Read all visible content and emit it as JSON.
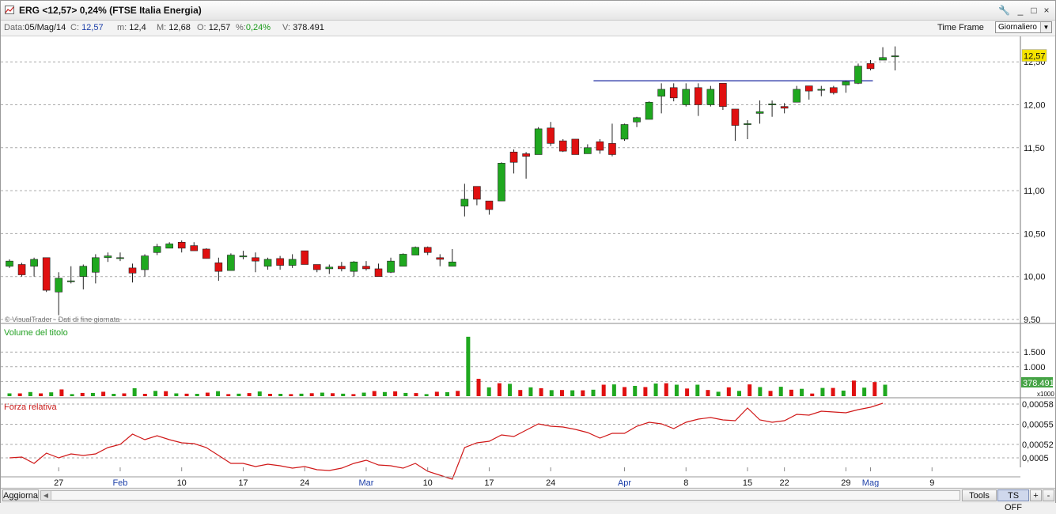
{
  "window": {
    "title": "ERG <12,57> 0,24%  (FTSE Italia Energia)",
    "buttons": [
      "🔧",
      "_",
      "□",
      "×"
    ]
  },
  "infobar": {
    "data_label": "Data:",
    "data_value": "05/Mag/14",
    "close_label": "C:",
    "close_value": "12,57",
    "min_label": "m:",
    "min_value": "12,4",
    "max_label": "M:",
    "max_value": "12,68",
    "open_label": "O:",
    "open_value": "12,57",
    "pct_label": "%:",
    "pct_value": "0,24%",
    "vol_label": "V:",
    "vol_value": "378.491",
    "timeframe_label": "Time Frame",
    "timeframe_value": "Giornaliero"
  },
  "bottombar": {
    "refresh": "Aggiorna",
    "tools": "Tools",
    "ts": "TS OFF",
    "plus": "+",
    "minus": "-"
  },
  "colors": {
    "up": "#1fa81f",
    "down": "#e01010",
    "rs_line": "#d01818",
    "resistance": "#1c2aa0",
    "last_price_bg": "#f5e400",
    "volume_tag_bg": "#45a345"
  },
  "chart_data": {
    "type": "candlestick",
    "watermark": "© VisualTrader - Dati di fine giornata",
    "price_axis": {
      "ticks": [
        9.5,
        10.0,
        10.5,
        11.0,
        11.5,
        12.0,
        12.5
      ],
      "tick_labels": [
        "9,50",
        "10,00",
        "10,50",
        "11,00",
        "11,50",
        "12,00",
        "12,50"
      ],
      "range": [
        9.5,
        12.85
      ],
      "last_price_label": "12,57",
      "grid": true
    },
    "x_axis": {
      "labels": [
        {
          "text": "27",
          "index": 4,
          "month": false
        },
        {
          "text": "Feb",
          "index": 9,
          "month": true
        },
        {
          "text": "10",
          "index": 14,
          "month": false
        },
        {
          "text": "17",
          "index": 19,
          "month": false
        },
        {
          "text": "24",
          "index": 24,
          "month": false
        },
        {
          "text": "Mar",
          "index": 29,
          "month": true
        },
        {
          "text": "10",
          "index": 34,
          "month": false
        },
        {
          "text": "17",
          "index": 39,
          "month": false
        },
        {
          "text": "24",
          "index": 44,
          "month": false
        },
        {
          "text": "Apr",
          "index": 50,
          "month": true
        },
        {
          "text": "8",
          "index": 55,
          "month": false
        },
        {
          "text": "15",
          "index": 60,
          "month": false
        },
        {
          "text": "22",
          "index": 63,
          "month": false
        },
        {
          "text": "29",
          "index": 68,
          "month": false
        },
        {
          "text": "Mag",
          "index": 70,
          "month": true
        },
        {
          "text": "9",
          "index": 75,
          "month": false
        }
      ]
    },
    "resistance_line": {
      "from_index": 48,
      "to_index": 70,
      "value": 12.28
    },
    "candles": [
      [
        10.12,
        10.18,
        10.1,
        10.2
      ],
      [
        10.14,
        10.02,
        10.0,
        10.16
      ],
      [
        10.12,
        10.2,
        10.0,
        10.22
      ],
      [
        10.22,
        9.84,
        9.82,
        10.22
      ],
      [
        9.82,
        9.98,
        9.55,
        10.05
      ],
      [
        9.95,
        9.95,
        9.92,
        10.12
      ],
      [
        10.0,
        10.12,
        9.85,
        10.14
      ],
      [
        10.05,
        10.22,
        9.92,
        10.26
      ],
      [
        10.22,
        10.24,
        10.17,
        10.28
      ],
      [
        10.22,
        10.22,
        10.18,
        10.28
      ],
      [
        10.1,
        10.04,
        9.93,
        10.15
      ],
      [
        10.08,
        10.24,
        10.0,
        10.26
      ],
      [
        10.28,
        10.35,
        10.25,
        10.38
      ],
      [
        10.33,
        10.38,
        10.33,
        10.4
      ],
      [
        10.4,
        10.33,
        10.28,
        10.42
      ],
      [
        10.36,
        10.3,
        10.3,
        10.4
      ],
      [
        10.32,
        10.21,
        10.21,
        10.33
      ],
      [
        10.16,
        10.06,
        9.95,
        10.22
      ],
      [
        10.07,
        10.25,
        10.07,
        10.27
      ],
      [
        10.24,
        10.24,
        10.2,
        10.3
      ],
      [
        10.22,
        10.18,
        10.05,
        10.28
      ],
      [
        10.12,
        10.2,
        10.08,
        10.22
      ],
      [
        10.21,
        10.13,
        10.08,
        10.24
      ],
      [
        10.13,
        10.2,
        10.1,
        10.26
      ],
      [
        10.3,
        10.14,
        10.14,
        10.3
      ],
      [
        10.14,
        10.08,
        10.05,
        10.14
      ],
      [
        10.09,
        10.11,
        10.03,
        10.14
      ],
      [
        10.12,
        10.09,
        10.06,
        10.17
      ],
      [
        10.06,
        10.17,
        10.0,
        10.18
      ],
      [
        10.12,
        10.09,
        10.07,
        10.18
      ],
      [
        10.09,
        10.0,
        10.0,
        10.15
      ],
      [
        10.05,
        10.18,
        10.04,
        10.22
      ],
      [
        10.12,
        10.26,
        10.12,
        10.27
      ],
      [
        10.25,
        10.34,
        10.25,
        10.35
      ],
      [
        10.34,
        10.28,
        10.25,
        10.35
      ],
      [
        10.22,
        10.2,
        10.12,
        10.26
      ],
      [
        10.12,
        10.17,
        10.12,
        10.32
      ],
      [
        10.82,
        10.9,
        10.7,
        11.08
      ],
      [
        11.05,
        10.9,
        10.83,
        11.05
      ],
      [
        10.88,
        10.78,
        10.72,
        10.88
      ],
      [
        10.88,
        11.32,
        10.88,
        11.33
      ],
      [
        11.45,
        11.33,
        11.2,
        11.48
      ],
      [
        11.43,
        11.4,
        11.14,
        11.45
      ],
      [
        11.42,
        11.72,
        11.42,
        11.74
      ],
      [
        11.73,
        11.55,
        11.52,
        11.8
      ],
      [
        11.58,
        11.46,
        11.45,
        11.6
      ],
      [
        11.6,
        11.42,
        11.42,
        11.6
      ],
      [
        11.43,
        11.5,
        11.43,
        11.54
      ],
      [
        11.57,
        11.47,
        11.43,
        11.6
      ],
      [
        11.55,
        11.42,
        11.4,
        11.78
      ],
      [
        11.6,
        11.77,
        11.58,
        11.78
      ],
      [
        11.8,
        11.85,
        11.74,
        11.86
      ],
      [
        11.83,
        12.03,
        11.83,
        12.04
      ],
      [
        12.1,
        12.18,
        11.9,
        12.25
      ],
      [
        12.2,
        12.08,
        12.04,
        12.25
      ],
      [
        12.0,
        12.18,
        11.98,
        12.25
      ],
      [
        12.2,
        12.0,
        11.87,
        12.25
      ],
      [
        12.0,
        12.18,
        11.98,
        12.22
      ],
      [
        12.25,
        11.98,
        11.94,
        12.25
      ],
      [
        11.95,
        11.76,
        11.58,
        11.95
      ],
      [
        11.77,
        11.78,
        11.6,
        11.82
      ],
      [
        11.9,
        11.92,
        11.78,
        12.05
      ],
      [
        12.0,
        12.01,
        11.86,
        12.05
      ],
      [
        11.98,
        11.96,
        11.9,
        12.02
      ],
      [
        12.03,
        12.18,
        12.03,
        12.22
      ],
      [
        12.22,
        12.16,
        12.06,
        12.22
      ],
      [
        12.17,
        12.18,
        12.1,
        12.22
      ],
      [
        12.2,
        12.14,
        12.12,
        12.22
      ],
      [
        12.23,
        12.27,
        12.14,
        12.28
      ],
      [
        12.25,
        12.45,
        12.24,
        12.48
      ],
      [
        12.48,
        12.42,
        12.4,
        12.52
      ],
      [
        12.52,
        12.55,
        12.52,
        12.67
      ],
      [
        12.57,
        12.57,
        12.4,
        12.68
      ]
    ],
    "volume_panel": {
      "title": "Volume del titolo",
      "ticks_label": [
        "1.500",
        "1.000",
        "500"
      ],
      "ticks": [
        1500,
        1000,
        500
      ],
      "last_label": "378.491",
      "multiplier_label": "x1000",
      "values": [
        95,
        95,
        140,
        95,
        130,
        230,
        70,
        110,
        110,
        150,
        80,
        95,
        270,
        80,
        180,
        170,
        95,
        85,
        80,
        120,
        170,
        70,
        85,
        105,
        160,
        80,
        80,
        70,
        85,
        100,
        120,
        100,
        85,
        70,
        120,
        175,
        140,
        165,
        110,
        105,
        70,
        150,
        135,
        180,
        2020,
        590,
        300,
        440,
        420,
        210,
        300,
        270,
        205,
        210,
        200,
        200,
        220,
        390,
        400,
        310,
        350,
        310,
        430,
        440,
        390,
        260,
        390,
        210,
        150,
        300,
        180,
        400,
        310,
        180,
        320,
        220,
        250,
        90,
        280,
        280,
        190,
        530,
        290,
        480,
        390
      ]
    },
    "rs_panel": {
      "title": "Forza relativa",
      "tick_labels": [
        "0,00058",
        "0,00055",
        "0,00052",
        "0,0005"
      ],
      "ticks": [
        0.00058,
        0.00055,
        0.00052,
        0.0005
      ]
    }
  }
}
